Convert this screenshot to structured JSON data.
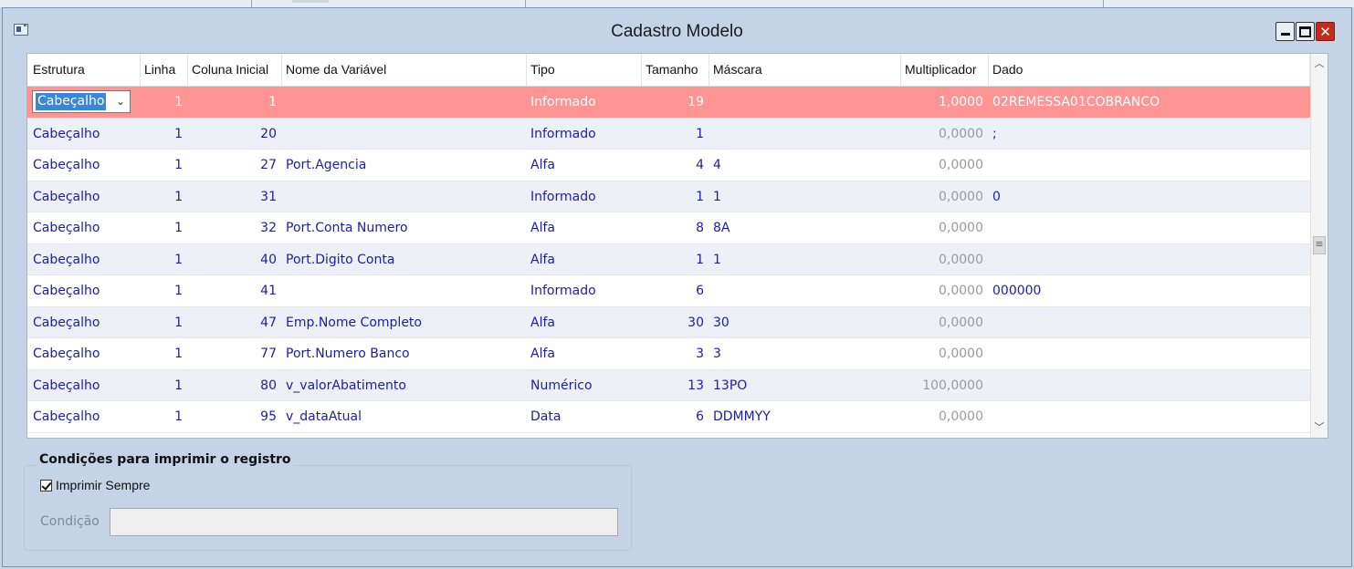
{
  "window": {
    "title": "Cadastro Modelo",
    "close_glyph": "✕"
  },
  "grid": {
    "columns": [
      "Estrutura",
      "Linha",
      "Coluna Inicial",
      "Nome da Variável",
      "Tipo",
      "Tamanho",
      "Máscara",
      "Multiplicador",
      "Dado"
    ],
    "rows": [
      [
        "Cabeçalho",
        "1",
        "1",
        "",
        "Informado",
        "19",
        "",
        "1,0000",
        "02REMESSA01COBRANCO"
      ],
      [
        "Cabeçalho",
        "1",
        "20",
        "",
        "Informado",
        "1",
        "",
        "0,0000",
        ";"
      ],
      [
        "Cabeçalho",
        "1",
        "27",
        "Port.Agencia",
        "Alfa",
        "4",
        "4",
        "0,0000",
        ""
      ],
      [
        "Cabeçalho",
        "1",
        "31",
        "",
        "Informado",
        "1",
        "1",
        "0,0000",
        "0"
      ],
      [
        "Cabeçalho",
        "1",
        "32",
        "Port.Conta Numero",
        "Alfa",
        "8",
        "8A",
        "0,0000",
        ""
      ],
      [
        "Cabeçalho",
        "1",
        "40",
        "Port.Digito Conta",
        "Alfa",
        "1",
        "1",
        "0,0000",
        ""
      ],
      [
        "Cabeçalho",
        "1",
        "41",
        "",
        "Informado",
        "6",
        "",
        "0,0000",
        "000000"
      ],
      [
        "Cabeçalho",
        "1",
        "47",
        "Emp.Nome Completo",
        "Alfa",
        "30",
        "30",
        "0,0000",
        ""
      ],
      [
        "Cabeçalho",
        "1",
        "77",
        "Port.Numero Banco",
        "Alfa",
        "3",
        "3",
        "0,0000",
        ""
      ],
      [
        "Cabeçalho",
        "1",
        "80",
        "v_valorAbatimento",
        "Numérico",
        "13",
        "13PO",
        "100,0000",
        ""
      ],
      [
        "Cabeçalho",
        "1",
        "95",
        "v_dataAtual",
        "Data",
        "6",
        "DDMMYY",
        "0,0000",
        ""
      ]
    ],
    "selected_row": 0,
    "scroll_up_glyph": "︿",
    "scroll_down_glyph": "﹀",
    "scroll_grip_glyph": "≡",
    "dropdown_glyph": "⌄"
  },
  "conditions": {
    "group_title": "Condições para imprimir o registro",
    "print_always_label": "Imprimir Sempre",
    "print_always_checked": true,
    "condition_label": "Condição",
    "condition_value": ""
  },
  "colors": {
    "selected_row": "#ff9494",
    "row_text": "#1c1cae",
    "alt_row": "#edf1f7",
    "window_bg": "#c4d4e6"
  },
  "icons": [
    "app-icon",
    "minimize-icon",
    "maximize-icon",
    "close-icon",
    "chevron-down-icon",
    "checkmark-icon"
  ]
}
